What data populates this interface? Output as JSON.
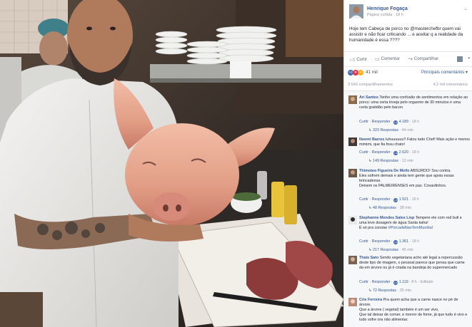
{
  "post": {
    "author": "Henrique Fogaça",
    "meta_page": "Página curtida",
    "meta_time": "18 h",
    "text": "Hoje tem Cabeça de porco no @masterchefbr quem vai assistir e não ficar criticando ... e aceitar q a realidade da humanidade é essa ????"
  },
  "actions": {
    "like": "Curtir",
    "comment": "Comentar",
    "share": "Compartilhar",
    "dropdown": "▾"
  },
  "reactions": {
    "count": "41 mil",
    "top_comments": "Principais comentários ▾",
    "shares": "3.542 compartilhamentos",
    "comments_count": "4,2 mil comentários"
  },
  "comments": [
    {
      "name": "Ari Santos",
      "text": "Tenho uma confusão de sentimentos em relação ao porco: uma certa inveja pelo orgasmo de 30 minutos e uma certa gratidão pelo bacon.",
      "reply": "Curtir · Responder ·",
      "likes": "4.189",
      "time": "18 h",
      "replies": "323 Respostas",
      "replies_time": "44 min",
      "avatar": "#8a6a4f"
    },
    {
      "name": "Noemi Barros",
      "text": "Iuhuuuuuu!! Falou tudo Chef! Mais ação e menos mimimi, que fia fosu chato!",
      "reply": "Curtir · Responder ·",
      "likes": "2.620",
      "time": "18 h",
      "replies": "149 Respostas",
      "replies_time": "12 min",
      "avatar": "#3f3a36"
    },
    {
      "name": "Thimoteo Figueira De Mello",
      "text": "ABSURDO! Sou contra.",
      "text2": "Eles sofrem demais e ainda tem gente que apoia essas brincadeiras.",
      "text3": "Deixem os PALMEIRENSES em paz. Covardinhos.",
      "reply": "Curtir · Responder ·",
      "likes": "1.521",
      "time": "16 h",
      "replies": "48 Respostas",
      "replies_time": "38 min",
      "avatar": "#6b5a4c"
    },
    {
      "name": "Stephanne Mendes Sales Lisp",
      "text": "Tempere ele com red bull e uma leve dosagem de água Santa kaha!",
      "text2": "É só pra constar",
      "hashtag": "#PorcadaNaoTemMundial",
      "reply": "Curtir · Responder ·",
      "likes": "1.361",
      "time": "18 h",
      "replies": "217 Respostas",
      "replies_time": "45 min",
      "avatar": "#2c2c2c"
    },
    {
      "name": "Thaís Sato",
      "text": "Sendo vegetariana acho até legal a repercussão deste tipo de imagem, o pessoal parece que pensa que carne da em árvore ou já é criada na bandeja do supermercado",
      "reply": "Curtir · Responder ·",
      "likes": "1.119",
      "time": "8 h",
      "edited": "Editado",
      "replies": "72 Respostas",
      "replies_time": "35 min",
      "avatar": "#7a6354"
    },
    {
      "name": "Crie Ferreira",
      "text": "Pra quem acha que a carne nasce no pé de árvore.",
      "text2": "Que a árvore ( vegetal) também é um ser vivo,",
      "text3": "Que tal deixar de comer, e morrer de fome, já que tudo é vivo e tudo sofre ora não alimentar.",
      "avatar": "#b98c7a"
    }
  ],
  "colors": {
    "link": "#365899",
    "meta": "#90949c",
    "like_blue": "#4267b2"
  }
}
